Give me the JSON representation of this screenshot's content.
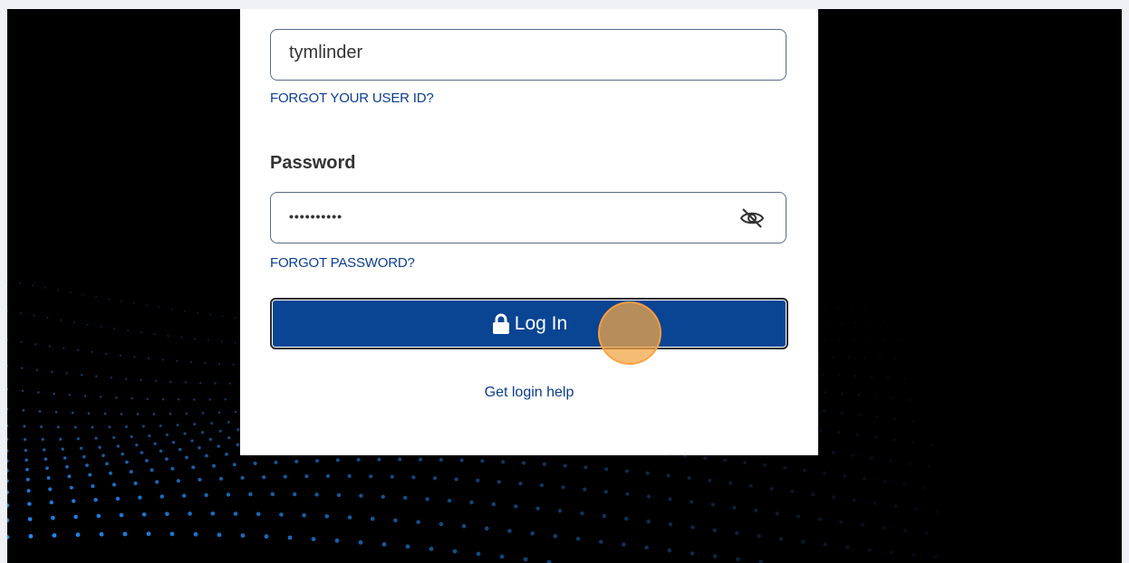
{
  "user_id": {
    "value": "tymlinder",
    "forgot_link": "FORGOT YOUR USER ID?"
  },
  "password": {
    "label": "Password",
    "masked_value": "••••••••••",
    "forgot_link": "FORGOT PASSWORD?",
    "toggle_icon": "eye-slash-icon"
  },
  "login_button": {
    "label": "Log In",
    "icon": "lock-icon"
  },
  "help_link": "Get login help",
  "colors": {
    "button_bg": "#0a4593",
    "link": "#0b3d91",
    "background": "#000000",
    "dots": "#1e8fff",
    "click_marker": "#f2a648"
  }
}
